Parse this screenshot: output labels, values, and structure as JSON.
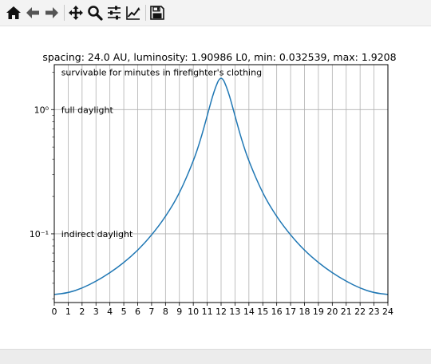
{
  "toolbar": {
    "buttons": [
      {
        "name": "home-button",
        "icon": "home-icon"
      },
      {
        "name": "back-button",
        "icon": "arrow-left-icon"
      },
      {
        "name": "forward-button",
        "icon": "arrow-right-icon"
      },
      {
        "name": "pan-button",
        "icon": "move-icon"
      },
      {
        "name": "zoom-button",
        "icon": "magnifier-icon"
      },
      {
        "name": "configure-subplots-button",
        "icon": "sliders-icon"
      },
      {
        "name": "edit-axis-button",
        "icon": "line-chart-icon"
      },
      {
        "name": "save-button",
        "icon": "floppy-disk-icon"
      }
    ]
  },
  "chart_data": {
    "type": "line",
    "title": "spacing: 24.0 AU, luminosity: 1.90986 L0, min: 0.032539, max: 1.9208",
    "xlabel": "",
    "ylabel": "",
    "xlim": [
      0,
      24
    ],
    "ylim": [
      0.028,
      2.3
    ],
    "yscale": "log",
    "grid": true,
    "x_ticks": [
      0,
      1,
      2,
      3,
      4,
      5,
      6,
      7,
      8,
      9,
      10,
      11,
      12,
      13,
      14,
      15,
      16,
      17,
      18,
      19,
      20,
      21,
      22,
      23,
      24
    ],
    "y_ticks": [
      {
        "value": 0.1,
        "label": "10⁻¹"
      },
      {
        "value": 1,
        "label": "10⁰"
      }
    ],
    "annotations": [
      {
        "text": "survivable for minutes in firefighter's clothing",
        "x": 0.5,
        "y": 2.0
      },
      {
        "text": "full daylight",
        "x": 0.5,
        "y": 1.0
      },
      {
        "text": "indirect daylight",
        "x": 0.5,
        "y": 0.1
      }
    ],
    "series": [
      {
        "color": "#1f77b4",
        "x": [
          0,
          1,
          2,
          3,
          4,
          5,
          6,
          7,
          8,
          9,
          10,
          10.5,
          11,
          11.5,
          12,
          12.5,
          13,
          13.5,
          14,
          15,
          16,
          17,
          18,
          19,
          20,
          21,
          22,
          23,
          24
        ],
        "y": [
          0.0325,
          0.0335,
          0.0365,
          0.0415,
          0.0485,
          0.0585,
          0.0735,
          0.0975,
          0.137,
          0.21,
          0.383,
          0.56,
          0.89,
          1.43,
          1.92,
          1.43,
          0.89,
          0.56,
          0.383,
          0.21,
          0.137,
          0.0975,
          0.0735,
          0.0585,
          0.0485,
          0.0415,
          0.0365,
          0.0335,
          0.0325
        ]
      }
    ]
  }
}
